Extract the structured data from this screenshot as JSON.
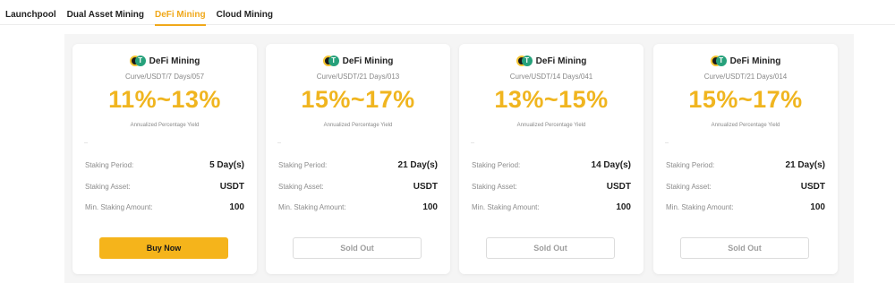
{
  "tabs": [
    {
      "label": "Launchpool"
    },
    {
      "label": "Dual Asset Mining"
    },
    {
      "label": "DeFi Mining"
    },
    {
      "label": "Cloud Mining"
    }
  ],
  "active_tab": "DeFi Mining",
  "accent_color": "#f0b51f",
  "labels": {
    "apy_caption": "Annualized Percentage Yield",
    "staking_period": "Staking Period:",
    "staking_asset": "Staking Asset:",
    "min_amount": "Min. Staking Amount:"
  },
  "cards": [
    {
      "product_name": "DeFi Mining",
      "code": "Curve/USDT/7 Days/057",
      "apy": "11%~13%",
      "staking_period": "5 Day(s)",
      "staking_asset": "USDT",
      "min_amount": "100",
      "button": "Buy Now",
      "button_state": "active"
    },
    {
      "product_name": "DeFi Mining",
      "code": "Curve/USDT/21 Days/013",
      "apy": "15%~17%",
      "staking_period": "21 Day(s)",
      "staking_asset": "USDT",
      "min_amount": "100",
      "button": "Sold Out",
      "button_state": "disabled"
    },
    {
      "product_name": "DeFi Mining",
      "code": "Curve/USDT/14 Days/041",
      "apy": "13%~15%",
      "staking_period": "14 Day(s)",
      "staking_asset": "USDT",
      "min_amount": "100",
      "button": "Sold Out",
      "button_state": "disabled"
    },
    {
      "product_name": "DeFi Mining",
      "code": "Curve/USDT/21 Days/014",
      "apy": "15%~17%",
      "staking_period": "21 Day(s)",
      "staking_asset": "USDT",
      "min_amount": "100",
      "button": "Sold Out",
      "button_state": "disabled"
    }
  ]
}
